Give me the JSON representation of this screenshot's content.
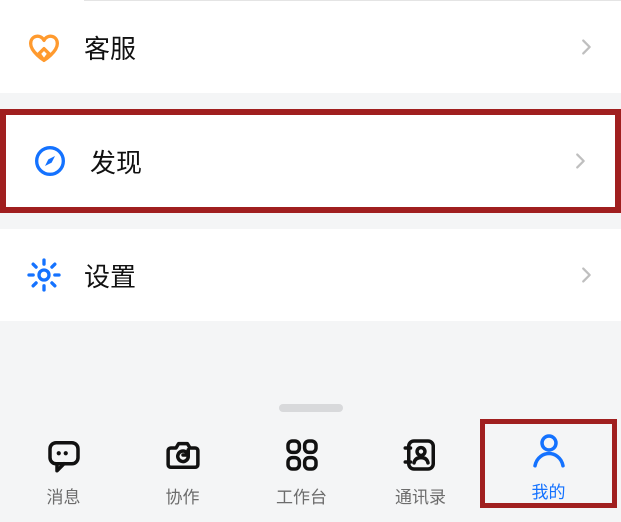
{
  "menu": {
    "customer_service": {
      "label": "客服"
    },
    "discover": {
      "label": "发现"
    },
    "settings": {
      "label": "设置"
    }
  },
  "tabs": {
    "messages": {
      "label": "消息"
    },
    "collab": {
      "label": "协作"
    },
    "workbench": {
      "label": "工作台"
    },
    "contacts": {
      "label": "通讯录"
    },
    "mine": {
      "label": "我的"
    }
  },
  "colors": {
    "accent": "#1472ff",
    "highlight_border": "#a01f1f"
  }
}
